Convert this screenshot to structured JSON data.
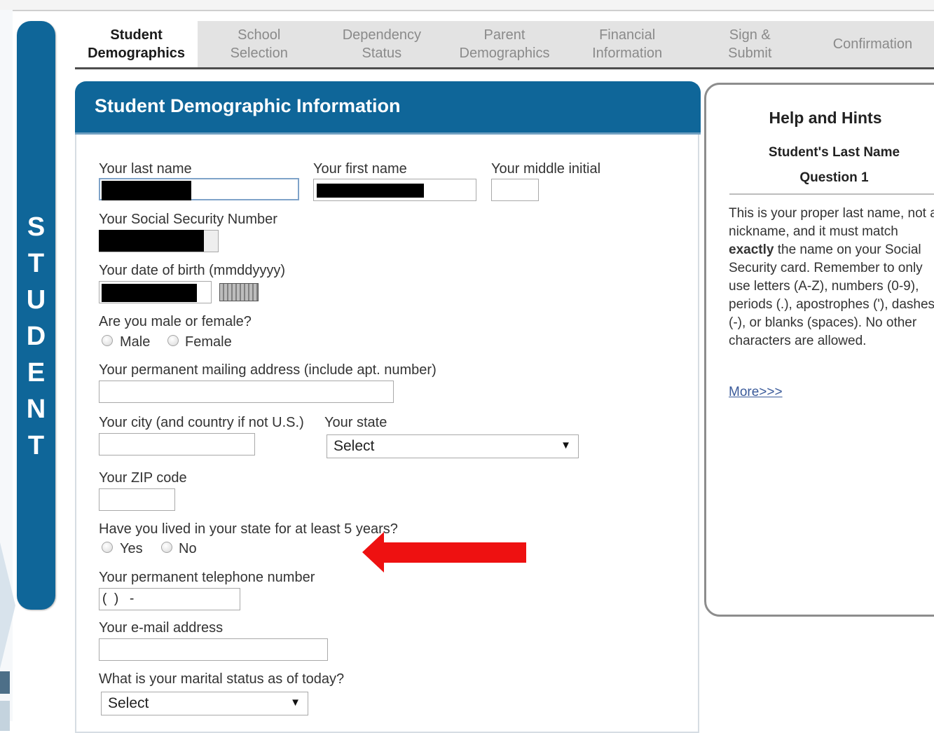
{
  "banner": {
    "letters": [
      "S",
      "T",
      "U",
      "D",
      "E",
      "N",
      "T"
    ]
  },
  "tabs": [
    {
      "label": "Student\nDemographics",
      "active": true
    },
    {
      "label": "School\nSelection",
      "active": false
    },
    {
      "label": "Dependency\nStatus",
      "active": false
    },
    {
      "label": "Parent\nDemographics",
      "active": false
    },
    {
      "label": "Financial\nInformation",
      "active": false
    },
    {
      "label": "Sign &\nSubmit",
      "active": false
    },
    {
      "label": "Confirmation",
      "active": false
    }
  ],
  "form": {
    "title": "Student Demographic Information",
    "last_name_label": "Your last name",
    "first_name_label": "Your first name",
    "middle_initial_label": "Your middle initial",
    "ssn_label": "Your Social Security Number",
    "dob_label": "Your date of birth (mmddyyyy)",
    "gender_label": "Are you male or female?",
    "gender_male": "Male",
    "gender_female": "Female",
    "address_label": "Your permanent mailing address (include apt. number)",
    "city_label": "Your city (and country if not U.S.)",
    "state_label": "Your state",
    "state_value": "Select",
    "zip_label": "Your ZIP code",
    "lived_label": "Have you lived in your state for at least 5 years?",
    "lived_yes": "Yes",
    "lived_no": "No",
    "phone_label": "Your permanent telephone number",
    "phone_value": "(  )   -",
    "email_label": "Your e-mail address",
    "marital_label": "What is your marital status as of today?",
    "marital_value": "Select",
    "select_arrow": "▼"
  },
  "help": {
    "title": "Help and Hints",
    "subtitle": "Student's Last Name",
    "question": "Question 1",
    "body_start": "This is your proper last name, not a nickname, and it must match ",
    "body_bold": "exactly",
    "body_end": " the name on your Social Security card. Remember to only use letters (A-Z), numbers (0-9), periods (.), apostrophes ('), dashes (-), or blanks (spaces). No other characters are allowed.",
    "more_link": "More>>>"
  },
  "colors": {
    "brand_blue": "#0f6699",
    "arrow_red": "#ee1111"
  }
}
